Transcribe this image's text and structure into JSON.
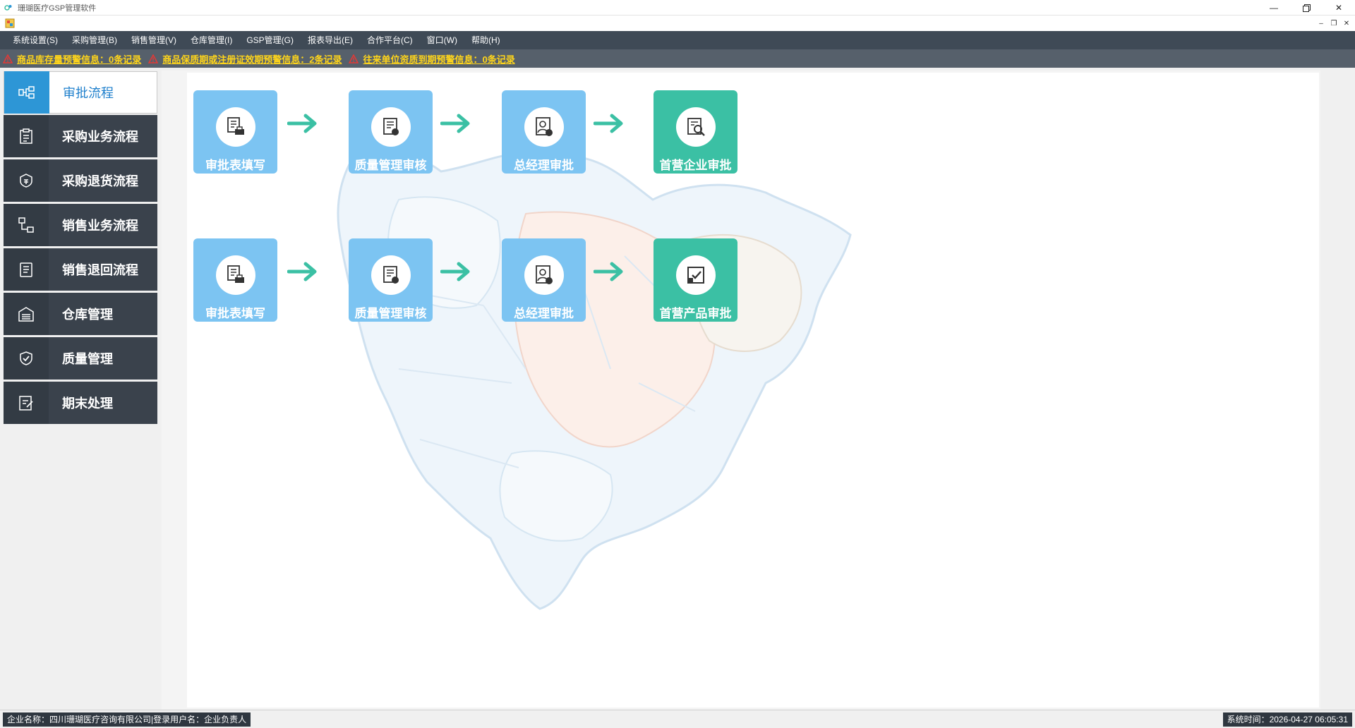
{
  "window": {
    "title": "珊瑚医疗GSP管理软件",
    "controls": [
      "minimize-icon",
      "restore-icon",
      "close-icon"
    ]
  },
  "menu": [
    {
      "label": "系统设置(S)"
    },
    {
      "label": "采购管理(B)"
    },
    {
      "label": "销售管理(V)"
    },
    {
      "label": "仓库管理(I)"
    },
    {
      "label": "GSP管理(G)"
    },
    {
      "label": "报表导出(E)"
    },
    {
      "label": "合作平台(C)"
    },
    {
      "label": "窗口(W)"
    },
    {
      "label": "帮助(H)"
    }
  ],
  "alerts": [
    {
      "text": "商品库存量预警信息：0条记录",
      "icon": "warning-icon"
    },
    {
      "text": "商品保质期或注册证效期预警信息：2条记录",
      "icon": "warning-icon"
    },
    {
      "text": "往来单位资质到期预警信息：0条记录",
      "icon": "warning-icon"
    }
  ],
  "sidebar": {
    "items": [
      {
        "label": "审批流程",
        "icon": "flow-icon",
        "active": true
      },
      {
        "label": "采购业务流程",
        "icon": "clipboard-icon"
      },
      {
        "label": "采购退货流程",
        "icon": "return-icon"
      },
      {
        "label": "销售业务流程",
        "icon": "sales-flow-icon"
      },
      {
        "label": "销售退回流程",
        "icon": "sales-return-icon"
      },
      {
        "label": "仓库管理",
        "icon": "warehouse-icon"
      },
      {
        "label": "质量管理",
        "icon": "shield-check-icon"
      },
      {
        "label": "期末处理",
        "icon": "period-end-icon"
      }
    ]
  },
  "flows": {
    "row1": [
      {
        "label": "审批表填写",
        "icon": "form-print-icon"
      },
      {
        "label": "质量管理审核",
        "icon": "quality-doc-icon"
      },
      {
        "label": "总经理审批",
        "icon": "manager-icon"
      },
      {
        "label": "首营企业审批",
        "icon": "doc-search-icon"
      }
    ],
    "row2": [
      {
        "label": "审批表填写",
        "icon": "form-print-icon"
      },
      {
        "label": "质量管理审核",
        "icon": "quality-doc-icon"
      },
      {
        "label": "总经理审批",
        "icon": "manager-icon"
      },
      {
        "label": "首营产品审批",
        "icon": "check-box-icon"
      }
    ],
    "arrow_icon": "right-arrow-icon"
  },
  "colors": {
    "menu_bg": "#3f4a56",
    "alert_bg": "#56606b",
    "alert_text": "#ffd51a",
    "sidebar_item_bg": "#3a424c",
    "active_accent": "#2d96d6",
    "step_blue": "#7cc4f2",
    "step_green": "#3bc0a4",
    "arrow": "#3bc0a4"
  },
  "status": {
    "left": "企业名称：四川珊瑚医疗咨询有限公司|登录用户名：企业负责人",
    "right": "系统时间：2026-04-27 06:05:31"
  }
}
